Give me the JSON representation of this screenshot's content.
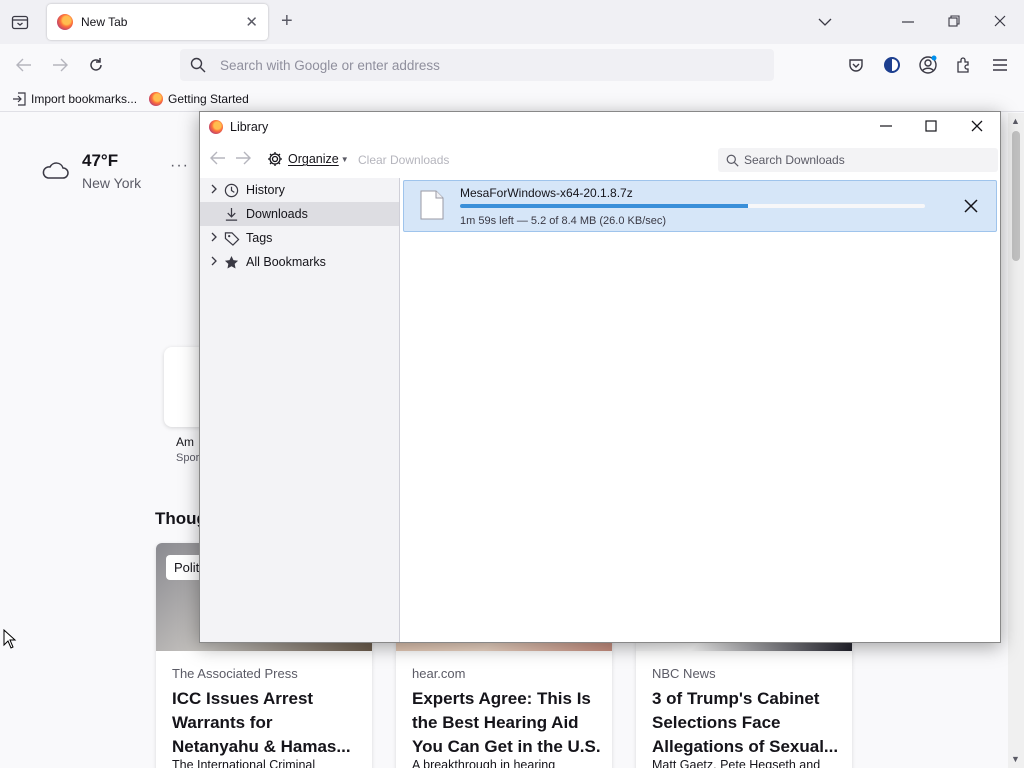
{
  "browser": {
    "tab": {
      "title": "New Tab",
      "close": "✕"
    },
    "new_tab": "+",
    "urlbar": {
      "placeholder": "Search with Google or enter address"
    },
    "bookmarks": [
      {
        "label": "Import bookmarks...",
        "icon": "import-icon"
      },
      {
        "label": "Getting Started",
        "icon": "firefox-icon"
      }
    ]
  },
  "newtab_page": {
    "weather": {
      "temp": "47°F",
      "city": "New York",
      "menu": "···"
    },
    "shortcut": {
      "label": "Am",
      "sub": "Spor"
    },
    "section_title": "Thoug",
    "cards": [
      {
        "tag": "Polit",
        "source": "The Associated Press",
        "headline": "ICC Issues Arrest Warrants for Netanyahu & Hamas...",
        "desc": "The International Criminal"
      },
      {
        "tag": "",
        "source": "hear.com",
        "headline": "Experts Agree: This Is the Best Hearing Aid You Can Get in the U.S.",
        "desc": "A breakthrough in hearing"
      },
      {
        "tag": "",
        "source": "NBC News",
        "headline": "3 of Trump's Cabinet Selections Face Allegations of Sexual...",
        "desc": "Matt Gaetz, Pete Hegseth and"
      }
    ]
  },
  "library": {
    "title": "Library",
    "toolbar": {
      "organize": "Organize",
      "clear_downloads": "Clear Downloads",
      "search_placeholder": "Search Downloads"
    },
    "sidebar": [
      {
        "label": "History",
        "icon": "clock-icon",
        "expandable": true,
        "selected": false
      },
      {
        "label": "Downloads",
        "icon": "download-icon",
        "expandable": false,
        "selected": true
      },
      {
        "label": "Tags",
        "icon": "tag-icon",
        "expandable": true,
        "selected": false
      },
      {
        "label": "All Bookmarks",
        "icon": "star-icon",
        "expandable": true,
        "selected": false
      }
    ],
    "downloads": [
      {
        "filename": "MesaForWindows-x64-20.1.8.7z",
        "status": "1m 59s left — 5.2 of 8.4 MB (26.0 KB/sec)",
        "progress": 0.62
      }
    ]
  },
  "colors": {
    "accent": "#3a8fd9",
    "selection": "#d6e6f8",
    "sidebar_selected": "#dddde2"
  }
}
